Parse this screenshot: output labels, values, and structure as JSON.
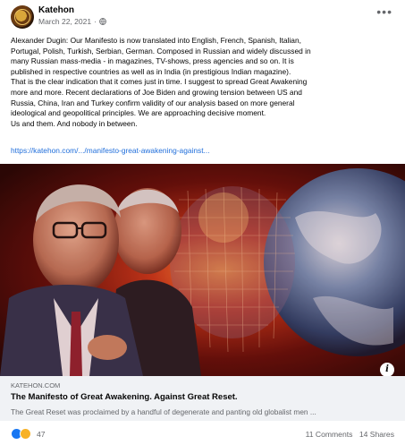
{
  "post": {
    "author": "Katehon",
    "date": "March 22, 2021",
    "audience_icon": "globe-icon",
    "more_icon": "more-options-icon",
    "text": [
      "Alexander Dugin: Our Manifesto is now translated into English, French, Spanish, Italian,",
      "Portugal, Polish, Turkish, Serbian, German. Composed in Russian and widely discussed in",
      "many Russian mass-media - in magazines, TV-shows, press agencies and so on. It is",
      "published in respective countries as well as in India (in prestigious Indian magazine).",
      "That is the clear indication that it comes just in time. I suggest to spread Great Awakening",
      "more and more. Recent declarations of Joe Biden and growing tension between US and",
      "Russia, China, Iran and Turkey confirm validity of our analysis based on more general",
      "ideological and geopolitical principles. We are approaching decisive moment.",
      "Us and them. And nobody in between."
    ],
    "link_text": "https://katehon.com/.../manifesto-great-awakening-against..."
  },
  "link_card": {
    "domain": "KATEHON.COM",
    "title": "The Manifesto of Great Awakening. Against Great Reset.",
    "description": "The Great Reset was proclaimed by a handful of degenerate and panting old globalist men ...",
    "info_icon": "info-icon"
  },
  "footer": {
    "reaction_icons": [
      "like-reaction-icon",
      "wow-reaction-icon"
    ],
    "reaction_count": "47",
    "comments": "11 Comments",
    "shares": "14 Shares"
  },
  "colors": {
    "link": "#216fdb",
    "secondary_text": "#65676b",
    "card_background": "#f0f2f5",
    "like": "#1877f2",
    "wow": "#f7b125"
  }
}
